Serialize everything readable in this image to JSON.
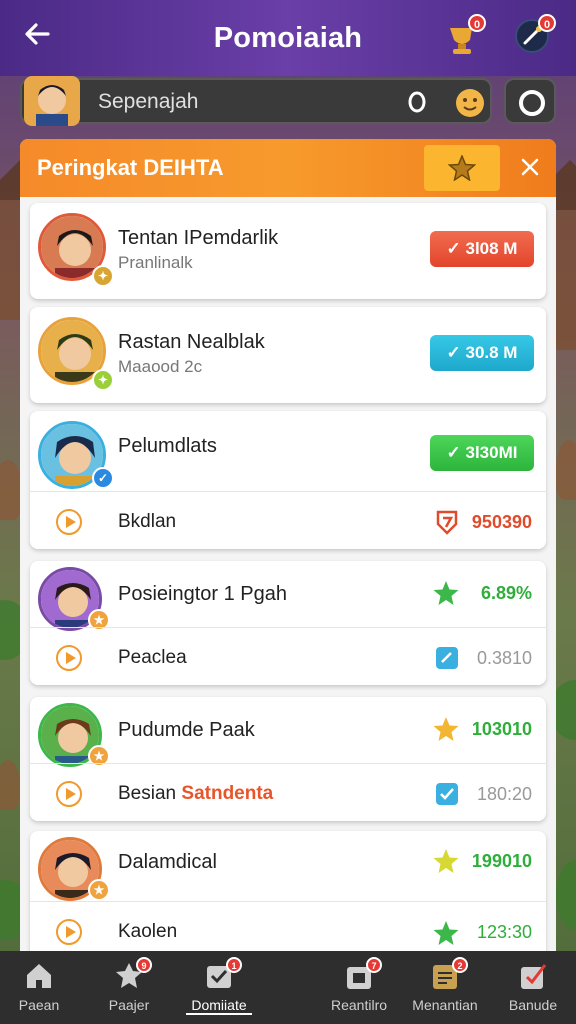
{
  "header": {
    "title": "Pomoiaiah",
    "back_icon": "arrow-left-icon",
    "trophy_badge": "0",
    "magic_badge": "0"
  },
  "search": {
    "placeholder": "Sepenajah"
  },
  "panel": {
    "title": "Peringkat DEIHTA"
  },
  "entries": [
    {
      "name": "Tentan IPemdarlik",
      "sub": "Pranlinalk",
      "value": "✓ 3l08 M",
      "color": "red"
    },
    {
      "name": "Rastan Nealblak",
      "sub": "Maaood 2c",
      "value": "✓ 30.8 M",
      "color": "blue"
    },
    {
      "name": "Pelumdlats",
      "value": "✓ 3l30MI",
      "color": "green",
      "sub_row": {
        "label": "Bkdlan",
        "value": "950390",
        "value_color": "#e04b2b",
        "icon_color": "#e04b2b"
      }
    },
    {
      "name": "Posieingtor 1 Pgah",
      "score": "6.89%",
      "score_color": "#2fae3c",
      "sub_row": {
        "label": "Peaclea",
        "value": "0.3810",
        "value_color": "#999999",
        "icon_color": "#3ab0e0"
      }
    },
    {
      "name": "Pudumde Paak",
      "score": "103010",
      "score_color": "#2fae3c",
      "sub_row": {
        "label": "Besian",
        "label_highlight": "Satndenta",
        "value": "180:20",
        "value_color": "#999999",
        "icon_color": "#3ab0e0"
      }
    },
    {
      "name": "Dalamdical",
      "score": "199010",
      "score_color": "#2fae3c",
      "sub_row": {
        "label": "Kaolen",
        "value": "123:30",
        "value_color": "#2fae3c",
        "icon_color": "#2fae3c"
      }
    }
  ],
  "nav": [
    {
      "label": "Paean",
      "icon": "home-icon",
      "badge": ""
    },
    {
      "label": "Paajer",
      "icon": "star-badge-icon",
      "badge": "9"
    },
    {
      "label": "Domiiate",
      "icon": "checklist-icon",
      "badge": "1"
    },
    {
      "label": "Reantilro",
      "icon": "gift-icon",
      "badge": "7"
    },
    {
      "label": "Menantian",
      "icon": "calendar-icon",
      "badge": "2"
    },
    {
      "label": "Banude",
      "icon": "checkbox-icon",
      "badge": ""
    }
  ]
}
